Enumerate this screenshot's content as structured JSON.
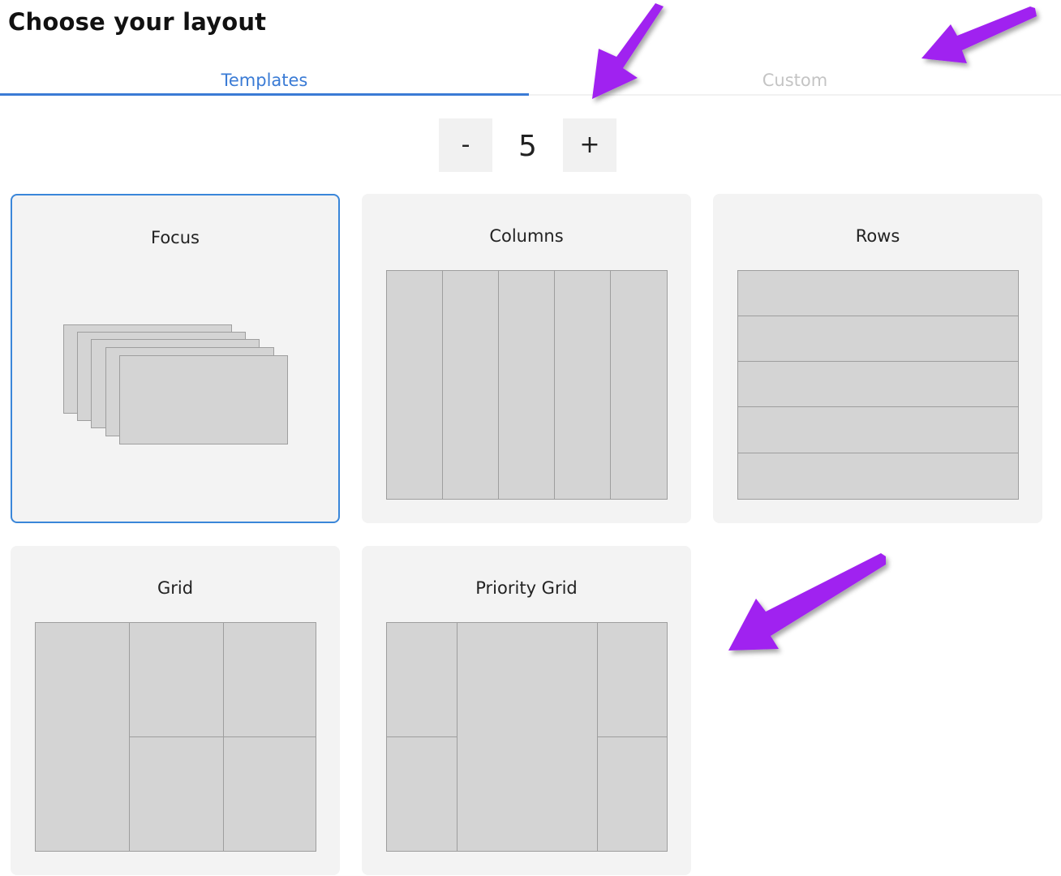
{
  "title": "Choose your layout",
  "tabs": [
    {
      "label": "Templates",
      "active": true
    },
    {
      "label": "Custom",
      "active": false
    }
  ],
  "stepper": {
    "minus_label": "-",
    "value": "5",
    "plus_label": "+"
  },
  "layouts": [
    {
      "label": "Focus",
      "selected": true
    },
    {
      "label": "Columns",
      "selected": false
    },
    {
      "label": "Rows",
      "selected": false
    },
    {
      "label": "Grid",
      "selected": false
    },
    {
      "label": "Priority Grid",
      "selected": false
    }
  ],
  "colors": {
    "accent": "#3a7bd5",
    "annotation_arrow": "#a020f0",
    "pane_fill": "#d4d4d4",
    "card_bg": "#f3f3f3"
  }
}
